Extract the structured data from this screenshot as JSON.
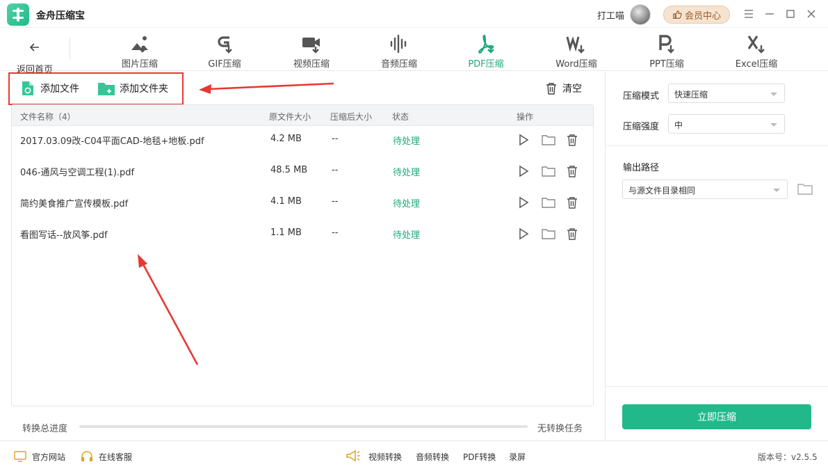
{
  "app": {
    "title": "金舟压缩宝",
    "username": "打工喵",
    "vip_label": "会员中心"
  },
  "toolbar": {
    "back_label": "返回首页",
    "tools": [
      {
        "label": "图片压缩",
        "icon": "image-icon"
      },
      {
        "label": "GIF压缩",
        "icon": "gif-icon"
      },
      {
        "label": "视频压缩",
        "icon": "video-icon"
      },
      {
        "label": "音频压缩",
        "icon": "audio-icon"
      },
      {
        "label": "PDF压缩",
        "icon": "pdf-icon",
        "active": true
      },
      {
        "label": "Word压缩",
        "icon": "word-icon"
      },
      {
        "label": "PPT压缩",
        "icon": "ppt-icon"
      },
      {
        "label": "Excel压缩",
        "icon": "excel-icon"
      }
    ]
  },
  "actions": {
    "add_file": "添加文件",
    "add_folder": "添加文件夹",
    "clear": "清空"
  },
  "table": {
    "headers": {
      "name": "文件名称（4）",
      "original_size": "原文件大小",
      "compressed_size": "压缩后大小",
      "status": "状态",
      "operation": "操作"
    },
    "rows": [
      {
        "name": "2017.03.09改-C04平面CAD-地毯+地板.pdf",
        "size": "4.2 MB",
        "compressed": "--",
        "status": "待处理"
      },
      {
        "name": "046-通风与空调工程(1).pdf",
        "size": "48.5 MB",
        "compressed": "--",
        "status": "待处理"
      },
      {
        "name": "简约美食推广宣传模板.pdf",
        "size": "4.1 MB",
        "compressed": "--",
        "status": "待处理"
      },
      {
        "name": "看图写话--放风筝.pdf",
        "size": "1.1 MB",
        "compressed": "--",
        "status": "待处理"
      }
    ]
  },
  "progress": {
    "label": "转换总进度",
    "status": "无转换任务",
    "value": 0
  },
  "settings": {
    "mode_label": "压缩模式",
    "mode_value": "快速压缩",
    "strength_label": "压缩强度",
    "strength_value": "中",
    "output_label": "输出路径",
    "output_value": "与源文件目录相同",
    "compress_button": "立即压缩"
  },
  "footer": {
    "website": "官方网站",
    "support": "在线客服",
    "links": [
      "视频转换",
      "音频转换",
      "PDF转换",
      "录屏"
    ],
    "version": "版本号：v2.5.5"
  },
  "colors": {
    "accent": "#22b98a",
    "status_pending": "#1fa87a",
    "annotation": "#e53935"
  }
}
